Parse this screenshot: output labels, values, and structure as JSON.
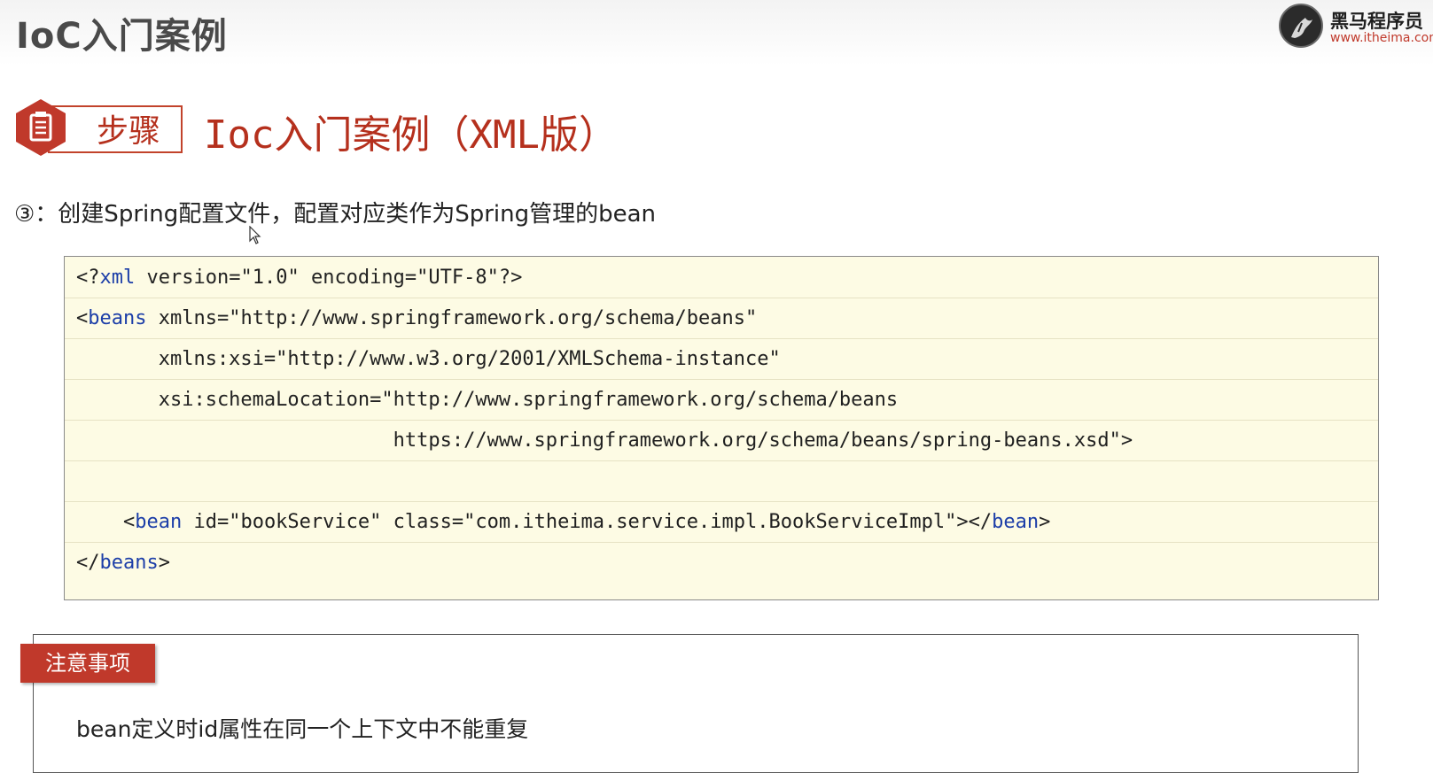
{
  "header": {
    "title": "IoC入门案例",
    "logo_name": "黑马程序员",
    "logo_url": "www.itheima.com"
  },
  "badge": {
    "label": "步骤",
    "icon": "document-icon"
  },
  "section_title": "Ioc入门案例（XML版）",
  "step": {
    "text": "③：创建Spring配置文件，配置对应类作为Spring管理的bean"
  },
  "code_lines": [
    "<?xml version=\"1.0\" encoding=\"UTF-8\"?>",
    "<beans xmlns=\"http://www.springframework.org/schema/beans\"",
    "       xmlns:xsi=\"http://www.w3.org/2001/XMLSchema-instance\"",
    "       xsi:schemaLocation=\"http://www.springframework.org/schema/beans",
    "                           https://www.springframework.org/schema/beans/spring-beans.xsd\">",
    "",
    "    <bean id=\"bookService\" class=\"com.itheima.service.impl.BookServiceImpl\"></bean>",
    "</beans>"
  ],
  "notice": {
    "tag": "注意事项",
    "text": "bean定义时id属性在同一个上下文中不能重复"
  },
  "colors": {
    "accent": "#c0392b",
    "code_background": "#fdfbe4",
    "xml_tag": "#1c3ea8",
    "xml_attribute": "#7b1fa2"
  }
}
